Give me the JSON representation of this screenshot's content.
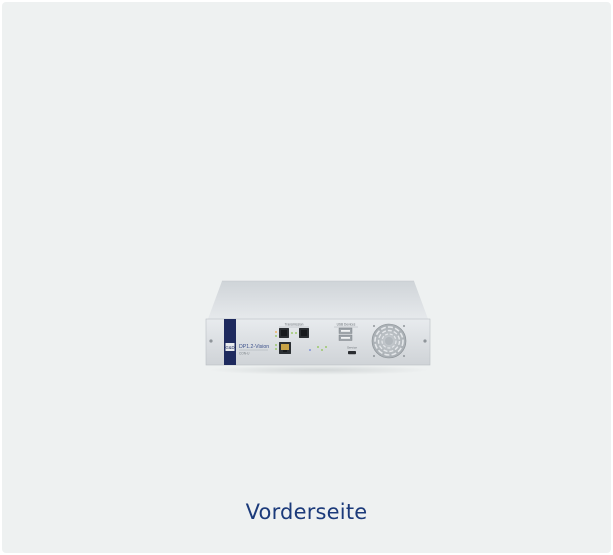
{
  "caption": "Vorderseite",
  "device": {
    "image_name": "KVM extender front panel",
    "brand_logo_text": "G&D",
    "model_name": "DP1.2-Vision",
    "model_variant": "CON-U",
    "section_transmission": "Transmission",
    "section_usb": "USB Devices",
    "port_service": "Service"
  },
  "colors": {
    "background": "#eef1f1",
    "caption": "#1b3a7a",
    "brand_stripe": "#1e2a5e",
    "panel": "#d9dde1"
  }
}
